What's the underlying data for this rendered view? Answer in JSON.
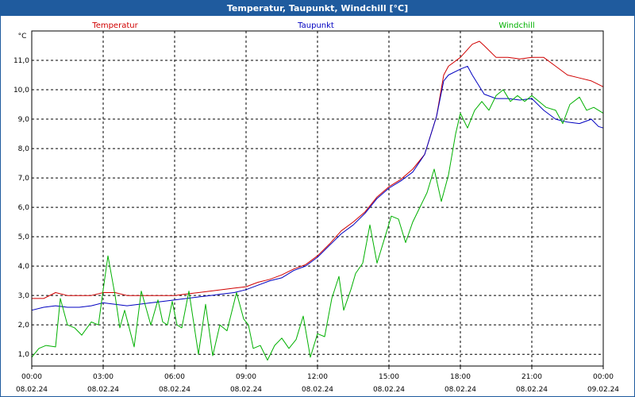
{
  "chart_data": {
    "type": "line",
    "title": "Temperatur, Taupunkt, Windchill [°C]",
    "ylabel": "°C",
    "ylim": [
      0.6,
      12.0
    ],
    "yticks": [
      1.0,
      2.0,
      3.0,
      4.0,
      5.0,
      6.0,
      7.0,
      8.0,
      9.0,
      10.0,
      11.0
    ],
    "ytick_labels": [
      "1,0",
      "2,0",
      "3,0",
      "4,0",
      "5,0",
      "6,0",
      "7,0",
      "8,0",
      "9,0",
      "10,0",
      "11,0"
    ],
    "xlim": [
      0,
      24
    ],
    "xticks": [
      {
        "x": 0,
        "time": "00:00",
        "date": "08.02.24"
      },
      {
        "x": 3,
        "time": "03:00",
        "date": "08.02.24"
      },
      {
        "x": 6,
        "time": "06:00",
        "date": "08.02.24"
      },
      {
        "x": 9,
        "time": "09:00",
        "date": "08.02.24"
      },
      {
        "x": 12,
        "time": "12:00",
        "date": "08.02.24"
      },
      {
        "x": 15,
        "time": "15:00",
        "date": "08.02.24"
      },
      {
        "x": 18,
        "time": "18:00",
        "date": "08.02.24"
      },
      {
        "x": 21,
        "time": "21:00",
        "date": "08.02.24"
      },
      {
        "x": 24,
        "time": "00:00",
        "date": "09.02.24"
      }
    ],
    "grid": true,
    "legend_position": "top",
    "series": [
      {
        "name": "Temperatur",
        "color": "#d00000",
        "points": [
          [
            0,
            2.9
          ],
          [
            0.5,
            2.9
          ],
          [
            1,
            3.1
          ],
          [
            1.5,
            3.0
          ],
          [
            2,
            3.0
          ],
          [
            2.5,
            3.0
          ],
          [
            3,
            3.1
          ],
          [
            3.5,
            3.1
          ],
          [
            4,
            3.0
          ],
          [
            4.5,
            3.0
          ],
          [
            5,
            3.0
          ],
          [
            5.5,
            3.0
          ],
          [
            6,
            3.0
          ],
          [
            6.5,
            3.05
          ],
          [
            7,
            3.1
          ],
          [
            7.5,
            3.15
          ],
          [
            8,
            3.2
          ],
          [
            8.5,
            3.25
          ],
          [
            9,
            3.3
          ],
          [
            9.5,
            3.45
          ],
          [
            10,
            3.55
          ],
          [
            10.5,
            3.7
          ],
          [
            11,
            3.9
          ],
          [
            11.5,
            4.05
          ],
          [
            12,
            4.35
          ],
          [
            12.5,
            4.75
          ],
          [
            13,
            5.2
          ],
          [
            13.5,
            5.5
          ],
          [
            14,
            5.85
          ],
          [
            14.5,
            6.35
          ],
          [
            15,
            6.7
          ],
          [
            15.5,
            6.95
          ],
          [
            16,
            7.3
          ],
          [
            16.5,
            7.8
          ],
          [
            17,
            9.1
          ],
          [
            17.3,
            10.5
          ],
          [
            17.5,
            10.8
          ],
          [
            18,
            11.1
          ],
          [
            18.5,
            11.55
          ],
          [
            18.8,
            11.65
          ],
          [
            19,
            11.5
          ],
          [
            19.5,
            11.1
          ],
          [
            20,
            11.1
          ],
          [
            20.5,
            11.05
          ],
          [
            21,
            11.1
          ],
          [
            21.5,
            11.1
          ],
          [
            22,
            10.8
          ],
          [
            22.5,
            10.5
          ],
          [
            23,
            10.4
          ],
          [
            23.5,
            10.3
          ],
          [
            24,
            10.1
          ]
        ]
      },
      {
        "name": "Taupunkt",
        "color": "#0000c0",
        "points": [
          [
            0,
            2.5
          ],
          [
            0.5,
            2.6
          ],
          [
            1,
            2.65
          ],
          [
            1.5,
            2.6
          ],
          [
            2,
            2.6
          ],
          [
            2.5,
            2.65
          ],
          [
            3,
            2.75
          ],
          [
            3.5,
            2.7
          ],
          [
            4,
            2.65
          ],
          [
            4.5,
            2.7
          ],
          [
            5,
            2.75
          ],
          [
            5.5,
            2.8
          ],
          [
            6,
            2.85
          ],
          [
            6.5,
            2.9
          ],
          [
            7,
            2.95
          ],
          [
            7.5,
            3.0
          ],
          [
            8,
            3.05
          ],
          [
            8.5,
            3.1
          ],
          [
            9,
            3.2
          ],
          [
            9.5,
            3.35
          ],
          [
            10,
            3.5
          ],
          [
            10.5,
            3.6
          ],
          [
            11,
            3.85
          ],
          [
            11.5,
            4.0
          ],
          [
            12,
            4.3
          ],
          [
            12.5,
            4.7
          ],
          [
            13,
            5.1
          ],
          [
            13.5,
            5.4
          ],
          [
            14,
            5.8
          ],
          [
            14.5,
            6.3
          ],
          [
            15,
            6.65
          ],
          [
            15.5,
            6.9
          ],
          [
            16,
            7.2
          ],
          [
            16.5,
            7.8
          ],
          [
            17,
            9.1
          ],
          [
            17.3,
            10.3
          ],
          [
            17.5,
            10.5
          ],
          [
            18,
            10.7
          ],
          [
            18.3,
            10.8
          ],
          [
            18.5,
            10.5
          ],
          [
            19,
            9.85
          ],
          [
            19.5,
            9.7
          ],
          [
            20,
            9.7
          ],
          [
            20.5,
            9.65
          ],
          [
            21,
            9.7
          ],
          [
            21.5,
            9.3
          ],
          [
            22,
            9.0
          ],
          [
            22.5,
            8.9
          ],
          [
            23,
            8.85
          ],
          [
            23.5,
            9.0
          ],
          [
            23.8,
            8.75
          ],
          [
            24,
            8.7
          ]
        ]
      },
      {
        "name": "Windchill",
        "color": "#00b000",
        "points": [
          [
            0,
            0.9
          ],
          [
            0.3,
            1.2
          ],
          [
            0.6,
            1.3
          ],
          [
            1,
            1.25
          ],
          [
            1.2,
            2.9
          ],
          [
            1.5,
            2.0
          ],
          [
            1.8,
            1.9
          ],
          [
            2.1,
            1.65
          ],
          [
            2.5,
            2.1
          ],
          [
            2.8,
            2.0
          ],
          [
            3,
            3.2
          ],
          [
            3.2,
            4.35
          ],
          [
            3.5,
            3.0
          ],
          [
            3.7,
            1.9
          ],
          [
            3.9,
            2.5
          ],
          [
            4.3,
            1.25
          ],
          [
            4.6,
            3.15
          ],
          [
            5,
            2.0
          ],
          [
            5.3,
            2.85
          ],
          [
            5.5,
            2.1
          ],
          [
            5.7,
            2.0
          ],
          [
            5.9,
            2.8
          ],
          [
            6.1,
            2.0
          ],
          [
            6.3,
            1.9
          ],
          [
            6.6,
            3.15
          ],
          [
            7,
            1.0
          ],
          [
            7.3,
            2.7
          ],
          [
            7.6,
            0.95
          ],
          [
            7.9,
            2.0
          ],
          [
            8.2,
            1.8
          ],
          [
            8.6,
            3.1
          ],
          [
            8.9,
            2.2
          ],
          [
            9.1,
            2.0
          ],
          [
            9.3,
            1.2
          ],
          [
            9.6,
            1.3
          ],
          [
            9.9,
            0.8
          ],
          [
            10.2,
            1.3
          ],
          [
            10.5,
            1.55
          ],
          [
            10.8,
            1.2
          ],
          [
            11.1,
            1.5
          ],
          [
            11.4,
            2.3
          ],
          [
            11.7,
            0.9
          ],
          [
            12,
            1.7
          ],
          [
            12.3,
            1.6
          ],
          [
            12.6,
            2.9
          ],
          [
            12.9,
            3.65
          ],
          [
            13.1,
            2.5
          ],
          [
            13.4,
            3.2
          ],
          [
            13.6,
            3.75
          ],
          [
            13.9,
            4.1
          ],
          [
            14.2,
            5.4
          ],
          [
            14.5,
            4.1
          ],
          [
            14.8,
            4.9
          ],
          [
            15.1,
            5.7
          ],
          [
            15.4,
            5.6
          ],
          [
            15.7,
            4.8
          ],
          [
            16,
            5.5
          ],
          [
            16.3,
            6.0
          ],
          [
            16.6,
            6.5
          ],
          [
            16.9,
            7.3
          ],
          [
            17.2,
            6.2
          ],
          [
            17.5,
            7.1
          ],
          [
            17.8,
            8.5
          ],
          [
            18,
            9.2
          ],
          [
            18.3,
            8.7
          ],
          [
            18.6,
            9.3
          ],
          [
            18.9,
            9.6
          ],
          [
            19.2,
            9.3
          ],
          [
            19.5,
            9.8
          ],
          [
            19.8,
            10.0
          ],
          [
            20.1,
            9.6
          ],
          [
            20.4,
            9.8
          ],
          [
            20.7,
            9.6
          ],
          [
            21,
            9.8
          ],
          [
            21.3,
            9.6
          ],
          [
            21.6,
            9.4
          ],
          [
            22,
            9.3
          ],
          [
            22.3,
            8.85
          ],
          [
            22.6,
            9.5
          ],
          [
            23,
            9.75
          ],
          [
            23.3,
            9.3
          ],
          [
            23.6,
            9.4
          ],
          [
            24,
            9.2
          ]
        ]
      }
    ]
  }
}
